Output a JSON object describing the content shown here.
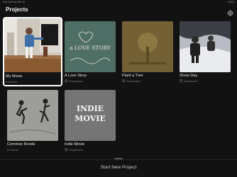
{
  "status_bar": {
    "time": "9:41 AM   Tue Oct 10",
    "right": "100%"
  },
  "header": {
    "title": "Projects"
  },
  "projects": [
    {
      "title": "My Movie",
      "subtitle": "Ed Movie",
      "type": "movie"
    },
    {
      "title": "A Love Story",
      "subtitle": "Storyboard",
      "type": "storyboard",
      "art_text": "a LOVE STORY"
    },
    {
      "title": "Plant a Tree",
      "subtitle": "Storyboard",
      "type": "storyboard"
    },
    {
      "title": "Snow Day",
      "subtitle": "Storyboard",
      "type": "storyboard"
    },
    {
      "title": "Common Bonds",
      "subtitle": "Ed Movie",
      "type": "movie"
    },
    {
      "title": "Indie Movie",
      "subtitle": "Storyboard",
      "type": "storyboard",
      "art_text_1": "INDIE",
      "art_text_2": "MOVIE"
    }
  ],
  "footer": {
    "start_label": "Start New Project"
  },
  "colors": {
    "background": "#121212",
    "selection": "#ffffff",
    "love_story_bg": "#4f6f66",
    "tree_bg": "#7d6a3a",
    "indie_bg": "#6c6c6c"
  }
}
